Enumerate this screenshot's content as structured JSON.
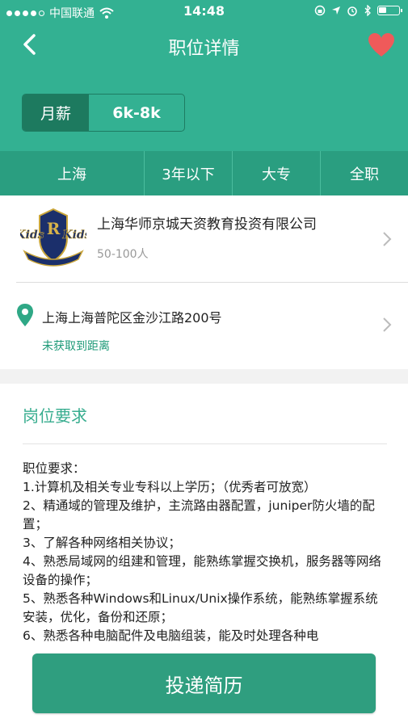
{
  "status_bar": {
    "carrier": "中国联通",
    "time": "14:48"
  },
  "nav": {
    "title": "职位详情"
  },
  "salary": {
    "label": "月薪",
    "value": "6k-8k"
  },
  "tags": [
    "上海",
    "3年以下",
    "大专",
    "全职"
  ],
  "company": {
    "name": "上海华师京城天资教育投资有限公司",
    "size": "50-100人",
    "logo_text": "Kids R Kids"
  },
  "address": {
    "text": "上海上海普陀区金沙江路200号",
    "distance": "未获取到距离"
  },
  "requirements": {
    "title": "岗位要求",
    "lines": [
      "职位要求：",
      "1.计算机及相关专业专科以上学历；（优秀者可放宽）",
      "2、精通域的管理及维护，主流路由器配置，juniper防火墙的配置；",
      "3、了解各种网络相关协议；",
      "4、熟悉局域网的组建和管理，能熟练掌握交换机，服务器等网络设备的操作；",
      "5、熟悉各种Windows和Linux/Unix操作系统，能熟练掌握系统安装，优化，备份和还原；",
      "6、熟悉各种电脑配件及电脑组装，能及时处理各种电"
    ]
  },
  "submit_label": "投递简历",
  "colors": {
    "primary": "#33b192",
    "dark": "#1d7a5f",
    "heart": "#ef5a5a"
  }
}
